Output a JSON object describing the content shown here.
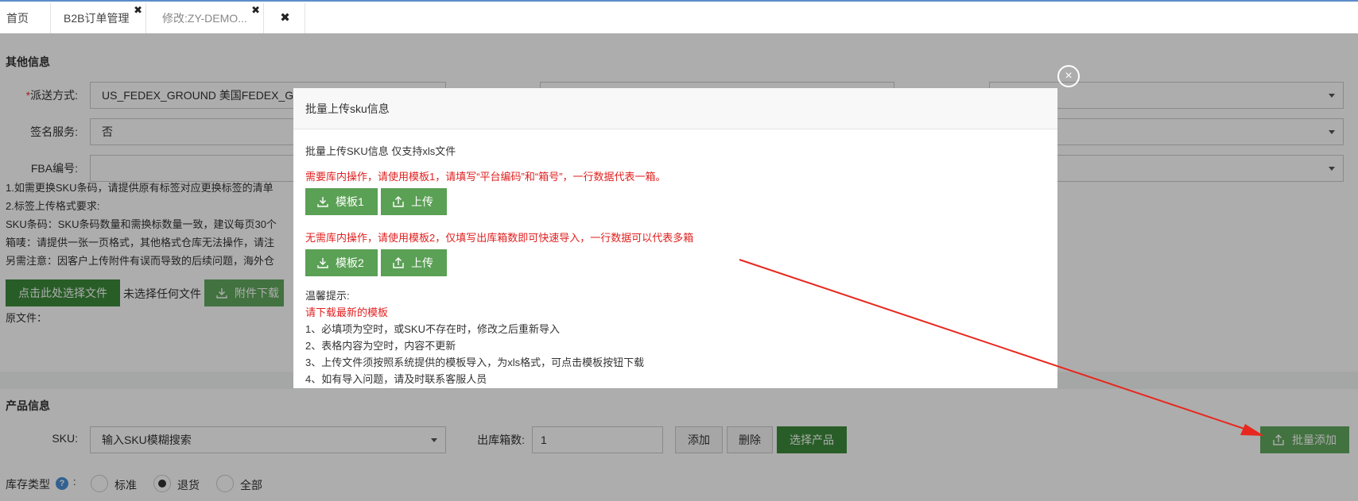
{
  "tabs": {
    "home": "首页",
    "b2b": "B2B订单管理",
    "edit": "修改:ZY-DEMO...",
    "close_glyph": "✖"
  },
  "other_info": {
    "title": "其他信息",
    "ship_label": "派送方式:",
    "ship_required": "*",
    "ship_value": "US_FEDEX_GROUND 美国FEDEX_GR",
    "sign_label": "签名服务:",
    "sign_value": "否",
    "fba_label": "FBA编号:",
    "fba_value": ""
  },
  "notes": [
    "1.如需更换SKU条码，请提供原有标签对应更换标签的清单",
    "2.标签上传格式要求:",
    "SKU条码：SKU条码数量和需换标数量一致，建议每页30个",
    "箱唛：请提供一张一页格式，其他格式仓库无法操作，请注",
    "另需注意：因客户上传附件有误而导致的后续问题，海外仓"
  ],
  "file": {
    "choose_label": "点击此处选择文件",
    "none_chosen": "未选择任何文件",
    "download_label": "附件下载",
    "original_label": "原文件："
  },
  "product_info": {
    "title": "产品信息",
    "sku_label": "SKU:",
    "sku_placeholder": "输入SKU模糊搜索",
    "boxes_label": "出库箱数:",
    "boxes_value": "1",
    "add_label": "添加",
    "delete_label": "删除",
    "select_label": "选择产品",
    "batch_add_label": "批量添加",
    "stock_type_label": "库存类型",
    "stock_type_colon": ":",
    "help_glyph": "?",
    "radio_standard": "标准",
    "radio_return": "退货",
    "radio_all": "全部"
  },
  "modal": {
    "title": "批量上传sku信息",
    "close_glyph": "×",
    "line1": "批量上传SKU信息 仅支持xls文件",
    "red1": "需要库内操作，请使用模板1，请填写“平台编码”和“箱号”，一行数据代表一箱。",
    "template1": "模板1",
    "upload1": "上传",
    "red2": "无需库内操作，请使用模板2，仅填写出库箱数即可快速导入，一行数据可以代表多箱",
    "template2": "模板2",
    "upload2": "上传",
    "tips_title": "温馨提示:",
    "tips_red": "请下载最新的模板",
    "tips": [
      "1、必填项为空时，或SKU不存在时，修改之后重新导入",
      "2、表格内容为空时，内容不更新",
      "3、上传文件须按照系统提供的模板导入，为xls格式，可点击模板按钮下载",
      "4、如有导入问题，请及时联系客服人员"
    ]
  },
  "colors": {
    "green_dark": "#3c8a3a",
    "green_light": "#62a85e",
    "red_text": "#e02020",
    "annotation_arrow": "#e8281e"
  }
}
